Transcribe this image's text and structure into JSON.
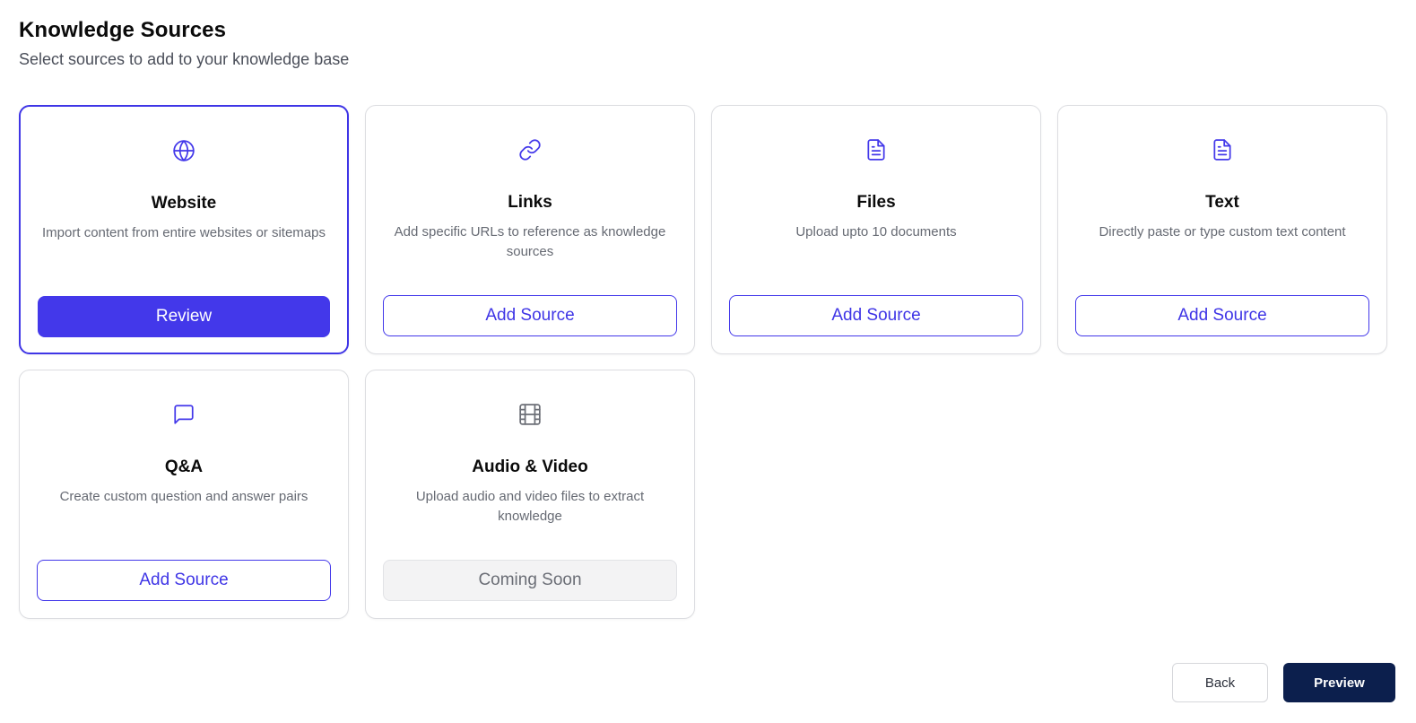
{
  "header": {
    "title": "Knowledge Sources",
    "subtitle": "Select sources to add to your knowledge base"
  },
  "colors": {
    "accent": "#4338EA",
    "primary_dark": "#0C1F4D",
    "icon_disabled": "#6B6E76"
  },
  "cards": [
    {
      "icon": "globe-icon",
      "title": "Website",
      "description": "Import content from entire websites or sitemaps",
      "button": "Review",
      "state": "selected"
    },
    {
      "icon": "link-icon",
      "title": "Links",
      "description": "Add specific URLs to reference as knowledge sources",
      "button": "Add Source",
      "state": "default"
    },
    {
      "icon": "file-text-icon",
      "title": "Files",
      "description": "Upload upto 10 documents",
      "button": "Add Source",
      "state": "default"
    },
    {
      "icon": "file-text-icon",
      "title": "Text",
      "description": "Directly paste or type custom text content",
      "button": "Add Source",
      "state": "default"
    },
    {
      "icon": "message-square-icon",
      "title": "Q&A",
      "description": "Create custom question and answer pairs",
      "button": "Add Source",
      "state": "default"
    },
    {
      "icon": "film-icon",
      "title": "Audio & Video",
      "description": "Upload audio and video files to extract knowledge",
      "button": "Coming Soon",
      "state": "disabled"
    }
  ],
  "footer": {
    "back_label": "Back",
    "preview_label": "Preview"
  }
}
